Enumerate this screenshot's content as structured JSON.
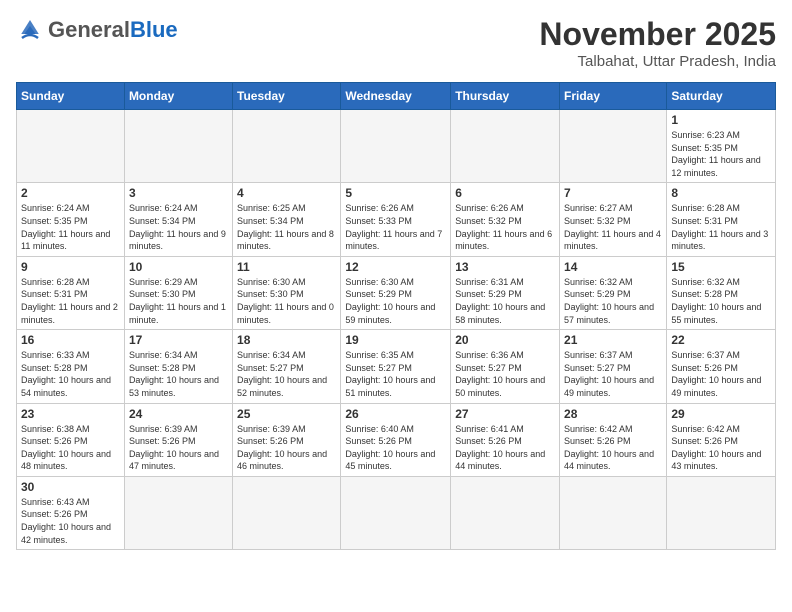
{
  "header": {
    "logo_general": "General",
    "logo_blue": "Blue",
    "month_title": "November 2025",
    "location": "Talbahat, Uttar Pradesh, India"
  },
  "weekdays": [
    "Sunday",
    "Monday",
    "Tuesday",
    "Wednesday",
    "Thursday",
    "Friday",
    "Saturday"
  ],
  "weeks": [
    [
      {
        "day": "",
        "info": ""
      },
      {
        "day": "",
        "info": ""
      },
      {
        "day": "",
        "info": ""
      },
      {
        "day": "",
        "info": ""
      },
      {
        "day": "",
        "info": ""
      },
      {
        "day": "",
        "info": ""
      },
      {
        "day": "1",
        "info": "Sunrise: 6:23 AM\nSunset: 5:35 PM\nDaylight: 11 hours\nand 12 minutes."
      }
    ],
    [
      {
        "day": "2",
        "info": "Sunrise: 6:24 AM\nSunset: 5:35 PM\nDaylight: 11 hours\nand 11 minutes."
      },
      {
        "day": "3",
        "info": "Sunrise: 6:24 AM\nSunset: 5:34 PM\nDaylight: 11 hours\nand 9 minutes."
      },
      {
        "day": "4",
        "info": "Sunrise: 6:25 AM\nSunset: 5:34 PM\nDaylight: 11 hours\nand 8 minutes."
      },
      {
        "day": "5",
        "info": "Sunrise: 6:26 AM\nSunset: 5:33 PM\nDaylight: 11 hours\nand 7 minutes."
      },
      {
        "day": "6",
        "info": "Sunrise: 6:26 AM\nSunset: 5:32 PM\nDaylight: 11 hours\nand 6 minutes."
      },
      {
        "day": "7",
        "info": "Sunrise: 6:27 AM\nSunset: 5:32 PM\nDaylight: 11 hours\nand 4 minutes."
      },
      {
        "day": "8",
        "info": "Sunrise: 6:28 AM\nSunset: 5:31 PM\nDaylight: 11 hours\nand 3 minutes."
      }
    ],
    [
      {
        "day": "9",
        "info": "Sunrise: 6:28 AM\nSunset: 5:31 PM\nDaylight: 11 hours\nand 2 minutes."
      },
      {
        "day": "10",
        "info": "Sunrise: 6:29 AM\nSunset: 5:30 PM\nDaylight: 11 hours\nand 1 minute."
      },
      {
        "day": "11",
        "info": "Sunrise: 6:30 AM\nSunset: 5:30 PM\nDaylight: 11 hours\nand 0 minutes."
      },
      {
        "day": "12",
        "info": "Sunrise: 6:30 AM\nSunset: 5:29 PM\nDaylight: 10 hours\nand 59 minutes."
      },
      {
        "day": "13",
        "info": "Sunrise: 6:31 AM\nSunset: 5:29 PM\nDaylight: 10 hours\nand 58 minutes."
      },
      {
        "day": "14",
        "info": "Sunrise: 6:32 AM\nSunset: 5:29 PM\nDaylight: 10 hours\nand 57 minutes."
      },
      {
        "day": "15",
        "info": "Sunrise: 6:32 AM\nSunset: 5:28 PM\nDaylight: 10 hours\nand 55 minutes."
      }
    ],
    [
      {
        "day": "16",
        "info": "Sunrise: 6:33 AM\nSunset: 5:28 PM\nDaylight: 10 hours\nand 54 minutes."
      },
      {
        "day": "17",
        "info": "Sunrise: 6:34 AM\nSunset: 5:28 PM\nDaylight: 10 hours\nand 53 minutes."
      },
      {
        "day": "18",
        "info": "Sunrise: 6:34 AM\nSunset: 5:27 PM\nDaylight: 10 hours\nand 52 minutes."
      },
      {
        "day": "19",
        "info": "Sunrise: 6:35 AM\nSunset: 5:27 PM\nDaylight: 10 hours\nand 51 minutes."
      },
      {
        "day": "20",
        "info": "Sunrise: 6:36 AM\nSunset: 5:27 PM\nDaylight: 10 hours\nand 50 minutes."
      },
      {
        "day": "21",
        "info": "Sunrise: 6:37 AM\nSunset: 5:27 PM\nDaylight: 10 hours\nand 49 minutes."
      },
      {
        "day": "22",
        "info": "Sunrise: 6:37 AM\nSunset: 5:26 PM\nDaylight: 10 hours\nand 49 minutes."
      }
    ],
    [
      {
        "day": "23",
        "info": "Sunrise: 6:38 AM\nSunset: 5:26 PM\nDaylight: 10 hours\nand 48 minutes."
      },
      {
        "day": "24",
        "info": "Sunrise: 6:39 AM\nSunset: 5:26 PM\nDaylight: 10 hours\nand 47 minutes."
      },
      {
        "day": "25",
        "info": "Sunrise: 6:39 AM\nSunset: 5:26 PM\nDaylight: 10 hours\nand 46 minutes."
      },
      {
        "day": "26",
        "info": "Sunrise: 6:40 AM\nSunset: 5:26 PM\nDaylight: 10 hours\nand 45 minutes."
      },
      {
        "day": "27",
        "info": "Sunrise: 6:41 AM\nSunset: 5:26 PM\nDaylight: 10 hours\nand 44 minutes."
      },
      {
        "day": "28",
        "info": "Sunrise: 6:42 AM\nSunset: 5:26 PM\nDaylight: 10 hours\nand 44 minutes."
      },
      {
        "day": "29",
        "info": "Sunrise: 6:42 AM\nSunset: 5:26 PM\nDaylight: 10 hours\nand 43 minutes."
      }
    ],
    [
      {
        "day": "30",
        "info": "Sunrise: 6:43 AM\nSunset: 5:26 PM\nDaylight: 10 hours\nand 42 minutes."
      },
      {
        "day": "",
        "info": ""
      },
      {
        "day": "",
        "info": ""
      },
      {
        "day": "",
        "info": ""
      },
      {
        "day": "",
        "info": ""
      },
      {
        "day": "",
        "info": ""
      },
      {
        "day": "",
        "info": ""
      }
    ]
  ]
}
